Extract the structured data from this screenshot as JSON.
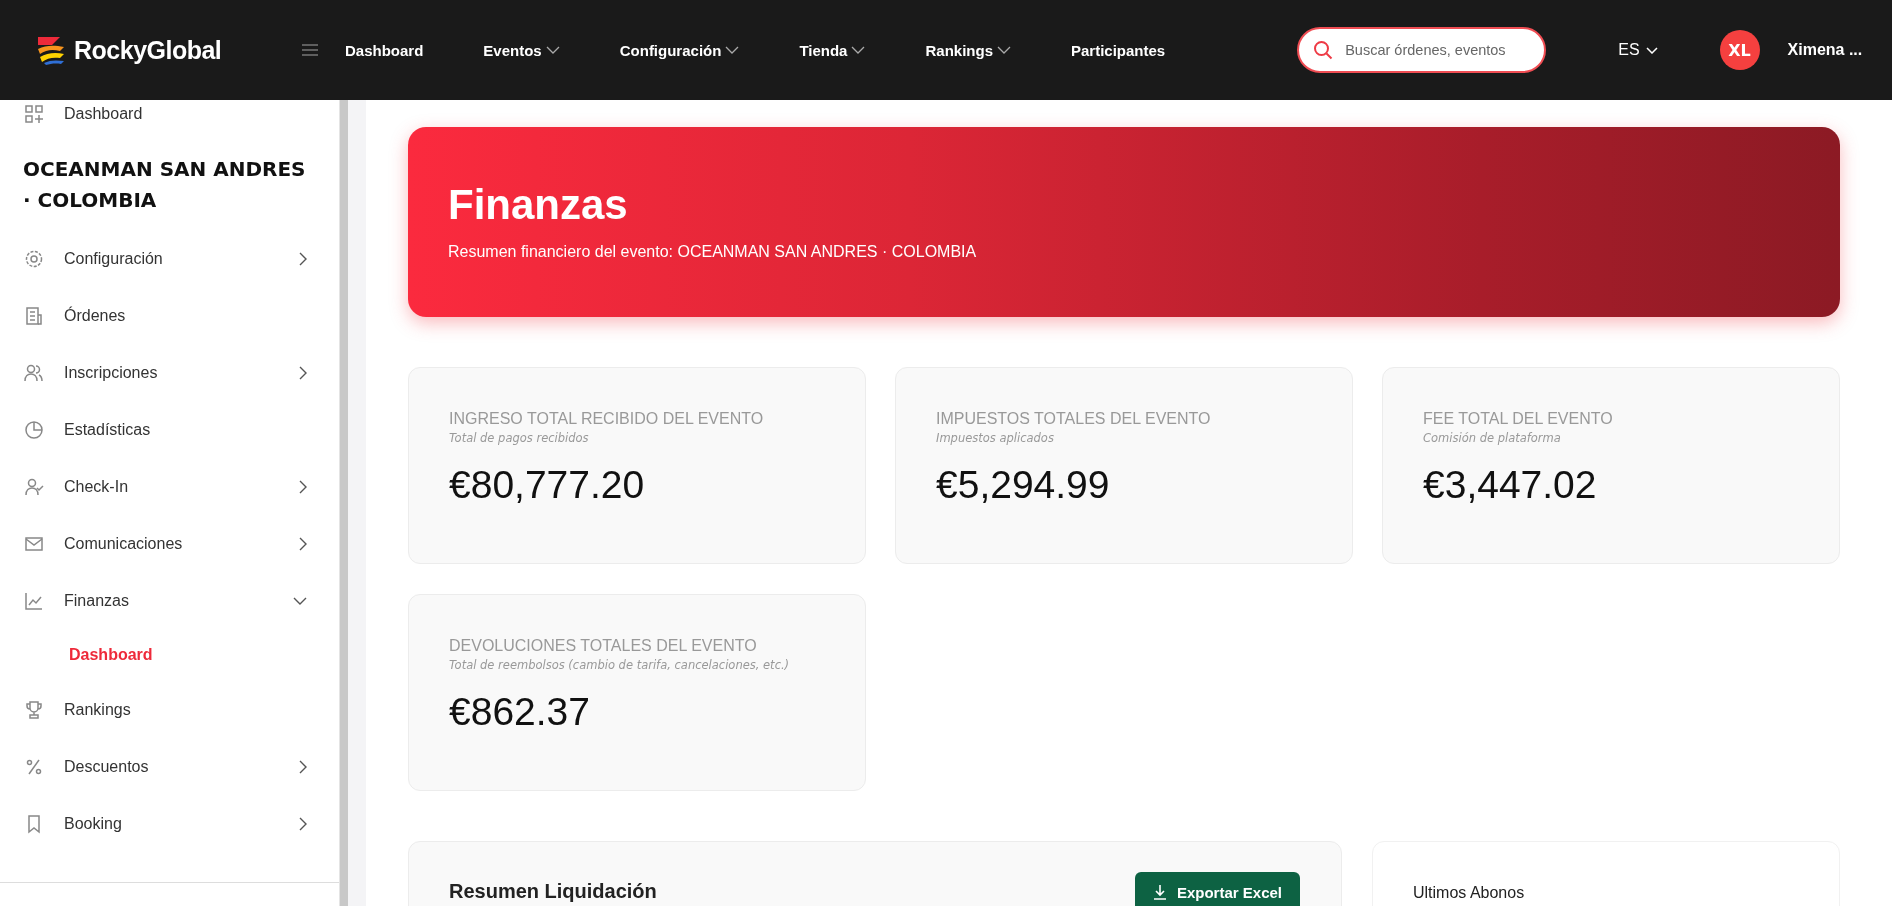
{
  "header": {
    "logo": "RockyGlobal",
    "nav": [
      {
        "label": "Dashboard",
        "has_dropdown": false
      },
      {
        "label": "Eventos",
        "has_dropdown": true
      },
      {
        "label": "Configuración",
        "has_dropdown": true
      },
      {
        "label": "Tienda",
        "has_dropdown": true
      },
      {
        "label": "Rankings",
        "has_dropdown": true
      },
      {
        "label": "Participantes",
        "has_dropdown": false
      }
    ],
    "search": {
      "placeholder": "Buscar órdenes, eventos"
    },
    "language": "ES",
    "avatar": "XL",
    "user": "Ximena ..."
  },
  "sidebar": {
    "top_item": "Dashboard",
    "event_title": "OCEANMAN SAN ANDRES · COLOMBIA",
    "items": [
      {
        "label": "Configuración",
        "expanded": false
      },
      {
        "label": "Órdenes"
      },
      {
        "label": "Inscripciones",
        "expanded": false
      },
      {
        "label": "Estadísticas"
      },
      {
        "label": "Check-In",
        "expanded": false
      },
      {
        "label": "Comunicaciones",
        "expanded": false
      },
      {
        "label": "Finanzas",
        "expanded": true,
        "children": [
          {
            "label": "Dashboard",
            "selected": true
          }
        ]
      },
      {
        "label": "Rankings"
      },
      {
        "label": "Descuentos",
        "expanded": false
      },
      {
        "label": "Booking",
        "expanded": false
      }
    ]
  },
  "hero": {
    "title": "Finanzas",
    "subtitle": "Resumen financiero del evento: OCEANMAN SAN ANDRES · COLOMBIA"
  },
  "stats": [
    {
      "label": "INGRESO TOTAL RECIBIDO DEL EVENTO",
      "hint": "Total de pagos recibidos",
      "value": "€80,777.20"
    },
    {
      "label": "IMPUESTOS TOTALES DEL EVENTO",
      "hint": "Impuestos aplicados",
      "value": "€5,294.99"
    },
    {
      "label": "FEE TOTAL DEL EVENTO",
      "hint": "Comisión de plataforma",
      "value": "€3,447.02"
    },
    {
      "label": "DEVOLUCIONES TOTALES DEL EVENTO",
      "hint": "Total de reembolsos (cambio de tarifa, cancelaciones, etc.)",
      "value": "€862.37"
    }
  ],
  "settlement": {
    "title": "Resumen Liquidación",
    "export_button": "Exportar Excel"
  },
  "payments": {
    "title": "Ultimos Abonos"
  }
}
